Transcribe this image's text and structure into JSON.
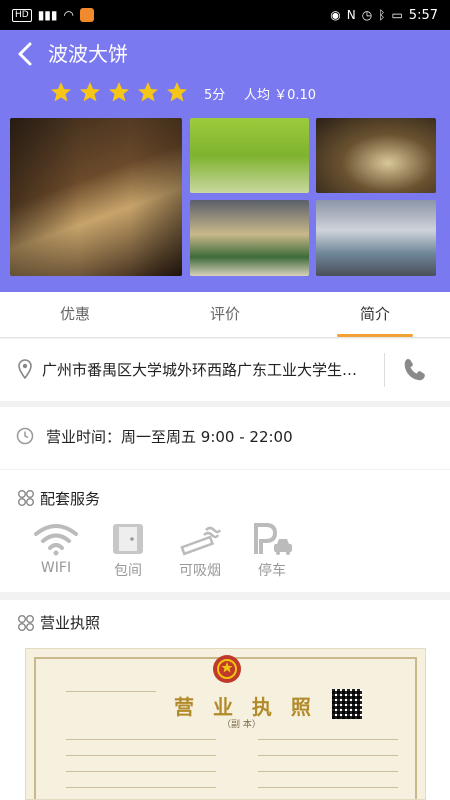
{
  "status_bar": {
    "network": "HD",
    "signal": "4G",
    "time": "5:57",
    "icons": [
      "eye-icon",
      "nfc-icon",
      "alarm-icon",
      "bluetooth-icon",
      "battery-icon"
    ]
  },
  "header": {
    "title": "波波大饼",
    "rating_stars": 5,
    "score": "5分",
    "avg_price": "人均 ￥0.10",
    "star_color": "#f5c518",
    "background": "#7b79f0"
  },
  "tabs": [
    {
      "label": "优惠",
      "active": false
    },
    {
      "label": "评价",
      "active": false
    },
    {
      "label": "简介",
      "active": true
    }
  ],
  "address": {
    "text": "广州市番禺区大学城外环西路广东工业大学生活区..."
  },
  "hours": {
    "text": "营业时间：周一至周五 9:00 - 22:00"
  },
  "services": {
    "title": "配套服务",
    "items": [
      {
        "label": "WIFI",
        "icon": "wifi-icon"
      },
      {
        "label": "包间",
        "icon": "door-icon"
      },
      {
        "label": "可吸烟",
        "icon": "cigarette-icon"
      },
      {
        "label": "停车",
        "icon": "parking-icon"
      }
    ]
  },
  "license": {
    "title": "营业执照",
    "heading": "营 业 执 照",
    "sub": "（副 本）"
  }
}
